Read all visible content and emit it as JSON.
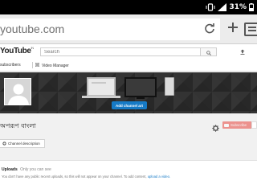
{
  "status_bar": {
    "battery": "31%",
    "icons": [
      "vibrate-icon",
      "signal-icon",
      "battery-icon"
    ]
  },
  "browser": {
    "url": "youtube.com",
    "icons": [
      "reload-icon",
      "new-tab-icon",
      "tabs-icon"
    ]
  },
  "youtube": {
    "logo": "YouTube",
    "logo_sup": "IN",
    "search": {
      "placeholder": "Search",
      "value": ""
    },
    "subscriptions_link": "subscribers",
    "video_manager_link": "Video Manager"
  },
  "banner": {
    "add_channel_art_label": "Add channel art"
  },
  "channel": {
    "name": "অপরূপ বাংলা",
    "subscribe_label": "Subscribe",
    "description_button": "Channel description"
  },
  "uploads": {
    "title": "Uploads",
    "visibility": "Only you can see",
    "message": "You don't have any public recent uploads, so this will not appear on your channel. To add content, ",
    "link": "upload a video."
  },
  "colors": {
    "accent_blue": "#167ac6",
    "subscribe_red": "#e62117"
  }
}
